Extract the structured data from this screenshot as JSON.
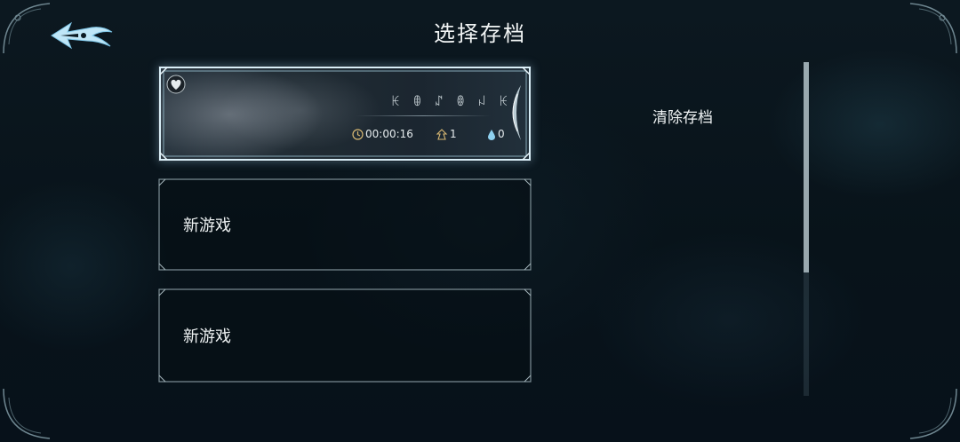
{
  "header": {
    "title": "选择存档",
    "back_icon": "ornate-back-arrow-icon"
  },
  "slots": [
    {
      "type": "save",
      "name_glyphs": "ꀘ ꂦ ꁴ ꂦ ꈤ ꀘ",
      "play_time": "00:00:16",
      "geo": "1",
      "essence": "0",
      "icons": [
        "clock-icon",
        "geo-icon",
        "essence-icon",
        "heart-badge-icon",
        "wing-emblem-icon"
      ]
    },
    {
      "type": "new",
      "label": "新游戏"
    },
    {
      "type": "new",
      "label": "新游戏"
    }
  ],
  "actions": {
    "clear_save": "清除存档"
  },
  "scroll": {
    "visible_fraction": 0.63,
    "position": 0
  },
  "colors": {
    "background": "#0a1319",
    "frame": "#c9d6dc",
    "selected_glow": "#a8d8ef",
    "text": "#eef2f3"
  }
}
